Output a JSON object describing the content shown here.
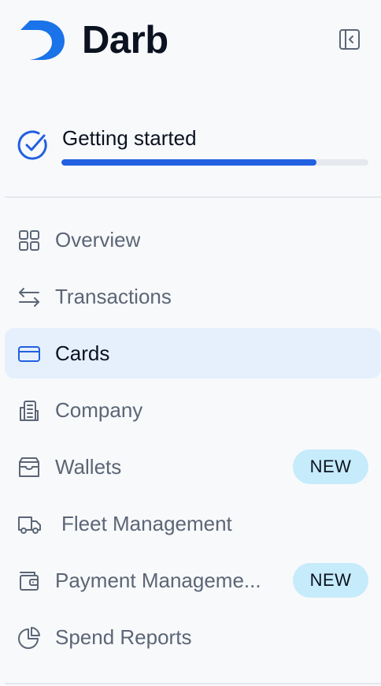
{
  "brand": {
    "name": "Darb",
    "logo_icon": "darb-logo-icon",
    "color": "#1a73e8"
  },
  "header": {
    "collapse_icon": "collapse-sidebar-icon"
  },
  "getting_started": {
    "title": "Getting started",
    "icon": "check-circle-icon",
    "progress": 0.83,
    "progress_color": "#2160e0"
  },
  "nav": {
    "items": [
      {
        "label": "Overview",
        "icon": "grid-icon",
        "active": false,
        "badge": ""
      },
      {
        "label": "Transactions",
        "icon": "transfer-arrows-icon",
        "active": false,
        "badge": ""
      },
      {
        "label": "Cards",
        "icon": "credit-card-icon",
        "active": true,
        "badge": ""
      },
      {
        "label": "Company",
        "icon": "building-icon",
        "active": false,
        "badge": ""
      },
      {
        "label": "Wallets",
        "icon": "wallet-icon",
        "active": false,
        "badge": "NEW"
      },
      {
        "label": "Fleet Management",
        "icon": "truck-icon",
        "active": false,
        "badge": ""
      },
      {
        "label": "Payment Manageme...",
        "icon": "payment-wallet-icon",
        "active": false,
        "badge": "NEW"
      },
      {
        "label": "Spend Reports",
        "icon": "pie-chart-icon",
        "active": false,
        "badge": ""
      }
    ]
  },
  "colors": {
    "active_bg": "#e6f0fc",
    "active_icon": "#2160e0",
    "text_muted": "#5b6676",
    "badge_bg": "#c6ebfb"
  }
}
